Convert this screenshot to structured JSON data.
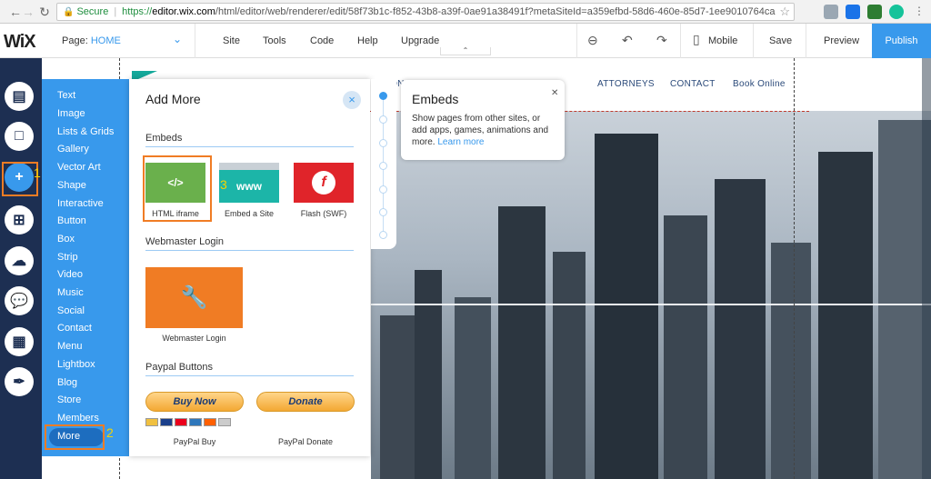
{
  "browser": {
    "secure_label": "Secure",
    "url_proto": "https://",
    "url_host": "editor.wix.com",
    "url_rest": "/html/editor/web/renderer/edit/58f73b1c-f852-43b8-a39f-0ae91a38491f?metaSiteId=a359efbd-58d6-460e-85d7-1ee9010764ca"
  },
  "wix_bar": {
    "logo": "WiX",
    "page_prefix": "Page:",
    "page_name": "HOME",
    "menu": [
      "Site",
      "Tools",
      "Code",
      "Help",
      "Upgrade"
    ],
    "mobile_label": "Mobile",
    "save_label": "Save",
    "preview_label": "Preview",
    "publish_label": "Publish"
  },
  "site": {
    "nav": [
      "ION",
      "ATTORNEYS",
      "CONTACT",
      "Book Online"
    ]
  },
  "categories": [
    "Text",
    "Image",
    "Lists & Grids",
    "Gallery",
    "Vector Art",
    "Shape",
    "Interactive",
    "Button",
    "Box",
    "Strip",
    "Video",
    "Music",
    "Social",
    "Contact",
    "Menu",
    "Lightbox",
    "Blog",
    "Store",
    "Members",
    "More"
  ],
  "add_panel": {
    "title": "Add More",
    "sections": {
      "embeds": "Embeds",
      "webmaster": "Webmaster Login",
      "paypal": "Paypal Buttons"
    },
    "tiles": {
      "iframe_label": "HTML iframe",
      "iframe_glyph": "</>",
      "site_label": "Embed a Site",
      "site_glyph": "www",
      "flash_label": "Flash (SWF)",
      "webmaster_label": "Webmaster Login",
      "paypal_buy_button": "Buy Now",
      "paypal_buy_label": "PayPal Buy",
      "paypal_donate_button": "Donate",
      "paypal_donate_label": "PayPal Donate"
    }
  },
  "tooltip": {
    "title": "Embeds",
    "text": "Show pages from other sites, or add apps, games, animations and more.",
    "link": "Learn more"
  },
  "annotations": {
    "one": "1",
    "two": "2",
    "three": "3"
  },
  "colors": {
    "wix_blue": "#3899ec",
    "rail": "#1d2f52",
    "callout": "#f07c24",
    "iframe_tile": "#6ab04c",
    "site_tile": "#1cb5a8",
    "flash_tile": "#e0242a",
    "webmaster_tile": "#f07c24"
  }
}
